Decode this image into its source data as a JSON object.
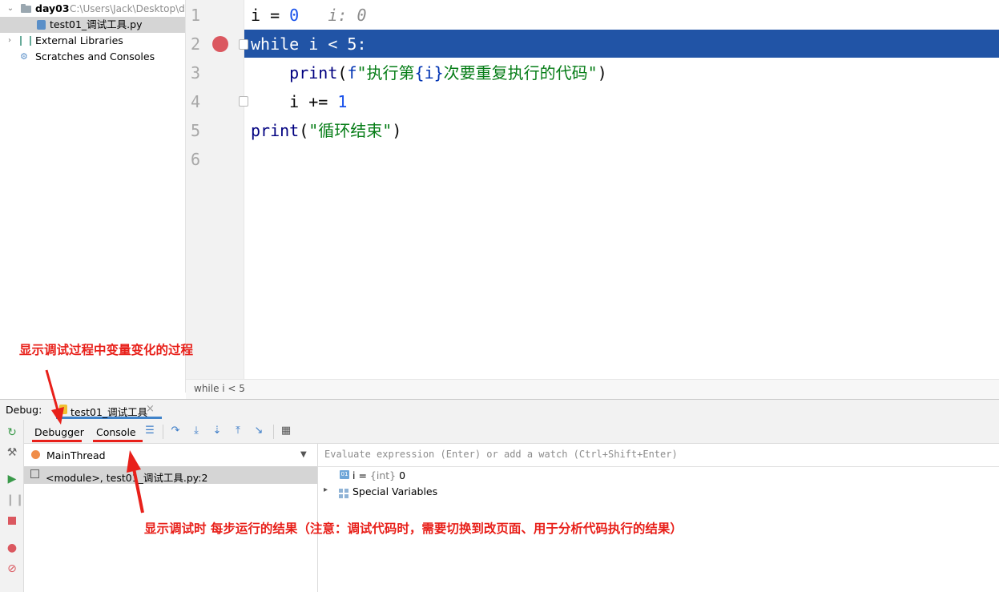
{
  "project_tree": {
    "root_label": "day03",
    "root_path": "C:\\Users\\Jack\\Desktop\\d",
    "file_label": "test01_调试工具.py",
    "external_libraries": "External Libraries",
    "scratches": "Scratches and Consoles"
  },
  "editor": {
    "line_numbers": [
      "1",
      "2",
      "3",
      "4",
      "5",
      "6"
    ],
    "line1": {
      "var": "i",
      "op": " = ",
      "val": "0",
      "inlay": "i: 0"
    },
    "line2": "while i < 5:",
    "line3": {
      "fn": "print",
      "open": "(",
      "fprefix": "f",
      "str1": "\"执行第",
      "brace": "{i}",
      "str2": "次要重复执行的代码\"",
      "close": ")"
    },
    "line4": {
      "var": "i",
      "op": " += ",
      "val": "1"
    },
    "line5": {
      "fn": "print",
      "open": "(",
      "str": "\"循环结束\"",
      "close": ")"
    },
    "breadcrumb": "while i < 5"
  },
  "debug": {
    "label": "Debug:",
    "tab_label": "test01_调试工具",
    "subtabs": {
      "debugger": "Debugger",
      "console": "Console"
    },
    "thread": "MainThread",
    "frame": "<module>, test01_调试工具.py:2",
    "eval_placeholder": "Evaluate expression (Enter) or add a watch (Ctrl+Shift+Enter)",
    "variable": {
      "icon_text": "01",
      "name": "i",
      "eq": " = ",
      "type": "{int}",
      "value": " 0"
    },
    "special_variables": "Special Variables"
  },
  "annotations": {
    "top": "显示调试过程中变量变化的过程",
    "bottom": "显示调试时 每步运行的结果（注意：调试代码时，需要切换到改页面、用于分析代码执行的结果）"
  },
  "colors": {
    "highlight": "#2154a6",
    "annotation": "#e8201a",
    "breakpoint": "#db5860"
  }
}
